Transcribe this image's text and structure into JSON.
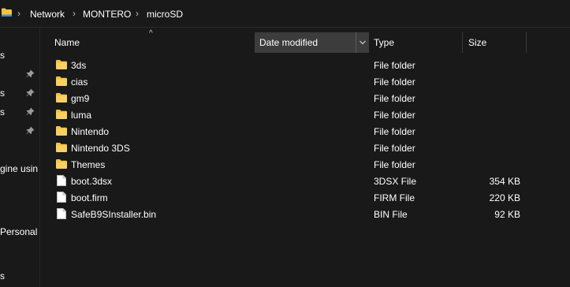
{
  "breadcrumb": {
    "items": [
      "Network",
      "MONTERO",
      "microSD"
    ],
    "separator": "›"
  },
  "nav": {
    "items": [
      {
        "label": "s",
        "pinned": false
      },
      {
        "label": "s",
        "pinned": true
      },
      {
        "label": "s",
        "pinned": true
      },
      {
        "label": "s",
        "pinned": true
      },
      {
        "label": "",
        "pinned": true
      },
      {
        "label": "gine usin",
        "pinned": false
      },
      {
        "label": "Personal",
        "pinned": false
      },
      {
        "label": "s",
        "pinned": false
      }
    ]
  },
  "columns": {
    "name": "Name",
    "date_modified": "Date modified",
    "type": "Type",
    "size": "Size",
    "sorted_column": "date_modified"
  },
  "files": [
    {
      "name": "3ds",
      "type": "File folder",
      "size": "",
      "icon": "folder-icon"
    },
    {
      "name": "cias",
      "type": "File folder",
      "size": "",
      "icon": "folder-icon"
    },
    {
      "name": "gm9",
      "type": "File folder",
      "size": "",
      "icon": "folder-icon"
    },
    {
      "name": "luma",
      "type": "File folder",
      "size": "",
      "icon": "folder-icon"
    },
    {
      "name": "Nintendo",
      "type": "File folder",
      "size": "",
      "icon": "folder-icon"
    },
    {
      "name": "Nintendo 3DS",
      "type": "File folder",
      "size": "",
      "icon": "folder-icon"
    },
    {
      "name": "Themes",
      "type": "File folder",
      "size": "",
      "icon": "folder-icon"
    },
    {
      "name": "boot.3dsx",
      "type": "3DSX File",
      "size": "354 KB",
      "icon": "file-icon"
    },
    {
      "name": "boot.firm",
      "type": "FIRM File",
      "size": "220 KB",
      "icon": "file-icon"
    },
    {
      "name": "SafeB9SInstaller.bin",
      "type": "BIN File",
      "size": "92 KB",
      "icon": "file-icon"
    }
  ],
  "colors": {
    "background": "#191919",
    "header_sorted_bg": "#3c3c3c",
    "folder_yellow": "#f5c342",
    "text": "#ffffff"
  }
}
